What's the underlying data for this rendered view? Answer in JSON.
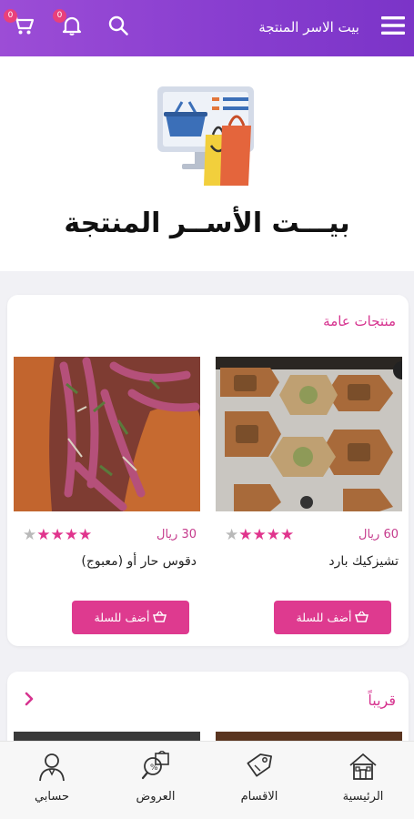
{
  "header": {
    "title": "بيت الاسر المنتجة",
    "cart_count": "0",
    "notif_count": "0"
  },
  "hero": {
    "title": "بيـــت الأســر المنتجة"
  },
  "general_section": {
    "title": "منتجات عامة",
    "products": [
      {
        "name": "تشيزكيك بارد",
        "price": "60 ريال",
        "rating": 4,
        "add_label": "أضف للسلة"
      },
      {
        "name": "دقوس حار أو (معبوج)",
        "price": "30 ريال",
        "rating": 4,
        "add_label": "أضف للسلة"
      }
    ]
  },
  "soon_section": {
    "title": "قريباً"
  },
  "bottom_nav": [
    {
      "label": "الرئيسية",
      "icon": "home-icon"
    },
    {
      "label": "الاقسام",
      "icon": "tag-icon"
    },
    {
      "label": "العروض",
      "icon": "offers-icon"
    },
    {
      "label": "حسابي",
      "icon": "user-icon"
    }
  ],
  "colors": {
    "header_gradient_start": "#9c4dd6",
    "header_gradient_end": "#7b34c8",
    "accent": "#de3a8f",
    "section_title": "#d6338f",
    "badge": "#e9407b"
  }
}
